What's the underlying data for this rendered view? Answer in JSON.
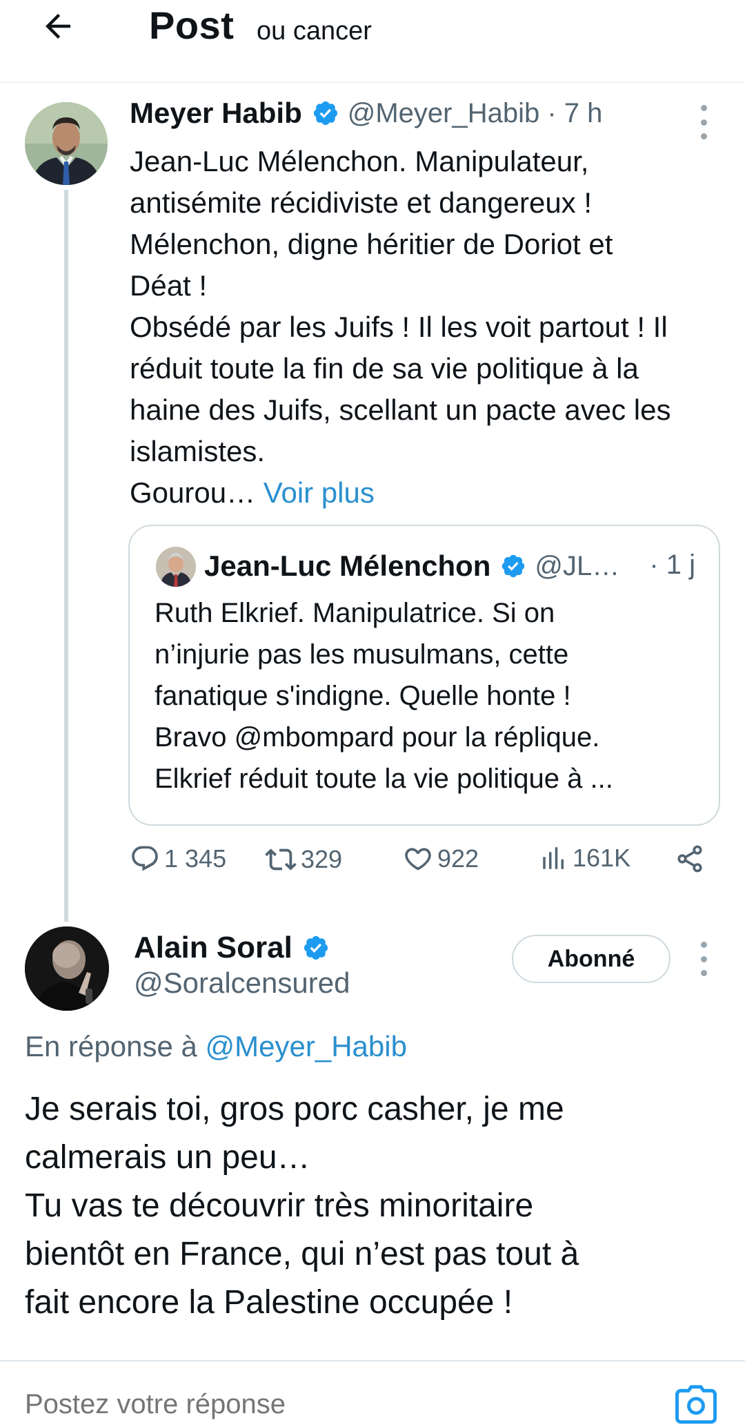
{
  "header": {
    "title": "Post",
    "subtitle": "ou cancer"
  },
  "colors": {
    "verified_blue": "#1d9bf0",
    "link_blue": "#2a8fcf",
    "secondary_text": "#536471",
    "border": "#cfd9de"
  },
  "main_tweet": {
    "name": "Meyer Habib",
    "handle": "@Meyer_Habib · 7 h",
    "lines": [
      "Jean-Luc Mélenchon. Manipulateur,",
      "antisémite récidiviste et dangereux !",
      "Mélenchon, digne héritier de Doriot et",
      "Déat !",
      "Obsédé par les Juifs ! Il les voit partout ! Il",
      "réduit toute la fin de sa vie politique à la",
      "haine des Juifs, scellant un pacte avec les",
      "islamistes."
    ],
    "truncated_text": "Gourou… ",
    "see_more": "Voir plus",
    "quote": {
      "name": "Jean-Luc Mélenchon",
      "handle": "@JL…",
      "time": "· 1 j",
      "lines": [
        "Ruth Elkrief. Manipulatrice. Si on",
        "n’injurie pas les musulmans, cette",
        "fanatique s'indigne. Quelle honte !",
        "Bravo @mbompard pour la réplique.",
        "Elkrief réduit toute la vie politique à ..."
      ]
    },
    "actions": {
      "replies": "1 345",
      "reposts": "329",
      "likes": "922",
      "views": "161K"
    }
  },
  "reply": {
    "name": "Alain Soral",
    "handle": "@Soralcensured",
    "follow_label": "Abonné",
    "reply_to_prefix": "En réponse à ",
    "reply_to_handle": "@Meyer_Habib",
    "lines": [
      "Je serais toi, gros porc casher, je me",
      "calmerais un peu…",
      "Tu vas te découvrir très minoritaire",
      "bientôt en France, qui n’est pas tout à",
      "fait encore la Palestine occupée !"
    ]
  },
  "composer": {
    "placeholder": "Postez votre réponse"
  },
  "icons": [
    "back-arrow-icon",
    "verified-badge-icon",
    "more-icon",
    "reply-icon",
    "repost-icon",
    "like-icon",
    "views-icon",
    "share-icon",
    "camera-icon"
  ]
}
